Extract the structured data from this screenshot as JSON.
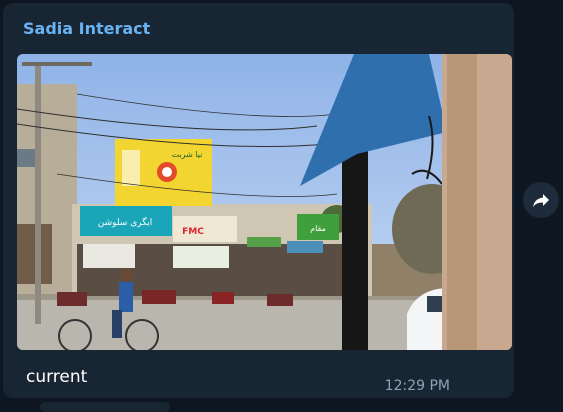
{
  "message": {
    "sender_name": "Sadia Interact",
    "caption": "current",
    "time": "12:29 PM"
  },
  "photo": {
    "signs": {
      "billboard_urdu": "نیا شربت",
      "left_banner": "ایگری سلوشن",
      "fmc": "FMC",
      "green_sign": "مقام"
    }
  },
  "icons": {
    "share": "share-forward-icon"
  },
  "colors": {
    "background": "#0e1621",
    "bubble": "#182533",
    "sender": "#6ab3f3",
    "caption": "#ffffff",
    "time": "#8fa3b5"
  }
}
